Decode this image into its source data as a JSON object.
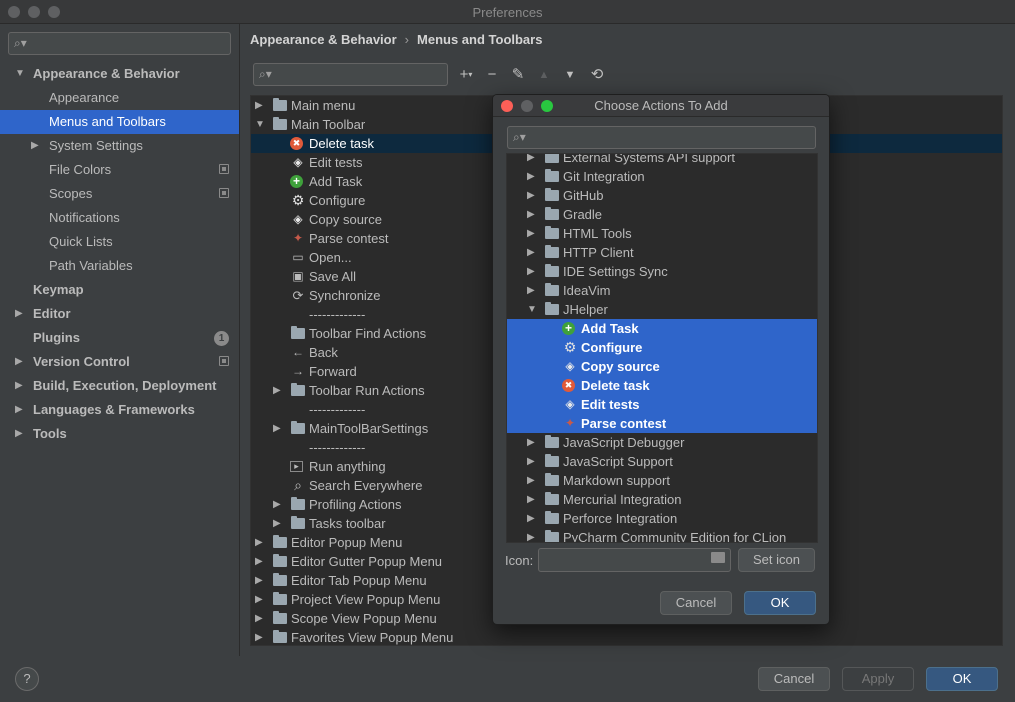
{
  "window": {
    "title": "Preferences"
  },
  "sidebar": {
    "search_placeholder": "",
    "items": [
      {
        "label": "Appearance & Behavior",
        "bold": true,
        "arrow": "down",
        "indent": 0
      },
      {
        "label": "Appearance",
        "indent": 1
      },
      {
        "label": "Menus and Toolbars",
        "indent": 1,
        "selected": true
      },
      {
        "label": "System Settings",
        "indent": 1,
        "arrow": "right"
      },
      {
        "label": "File Colors",
        "indent": 1,
        "project_icon": true
      },
      {
        "label": "Scopes",
        "indent": 1,
        "project_icon": true
      },
      {
        "label": "Notifications",
        "indent": 1
      },
      {
        "label": "Quick Lists",
        "indent": 1
      },
      {
        "label": "Path Variables",
        "indent": 1
      },
      {
        "label": "Keymap",
        "bold": true,
        "indent": 0
      },
      {
        "label": "Editor",
        "bold": true,
        "arrow": "right",
        "indent": 0
      },
      {
        "label": "Plugins",
        "bold": true,
        "indent": 0,
        "badge": "1"
      },
      {
        "label": "Version Control",
        "bold": true,
        "arrow": "right",
        "indent": 0,
        "project_icon": true
      },
      {
        "label": "Build, Execution, Deployment",
        "bold": true,
        "arrow": "right",
        "indent": 0
      },
      {
        "label": "Languages & Frameworks",
        "bold": true,
        "arrow": "right",
        "indent": 0
      },
      {
        "label": "Tools",
        "bold": true,
        "arrow": "right",
        "indent": 0
      }
    ]
  },
  "breadcrumb": {
    "parent": "Appearance & Behavior",
    "separator": "›",
    "current": "Menus and Toolbars"
  },
  "toolbar": {
    "search_placeholder": "",
    "icons": [
      "add-icon",
      "remove-icon",
      "edit-icon",
      "move-up-icon",
      "move-down-icon",
      "restore-icon"
    ]
  },
  "main_tree": [
    {
      "label": "Main menu",
      "level": 0,
      "arrow": "right",
      "icon": "folder"
    },
    {
      "label": "Main Toolbar",
      "level": 0,
      "arrow": "down",
      "icon": "folder"
    },
    {
      "label": "Delete task",
      "level": 1,
      "icon": "delete",
      "selected": true
    },
    {
      "label": "Edit tests",
      "level": 1,
      "icon": "tag"
    },
    {
      "label": "Add Task",
      "level": 1,
      "icon": "add"
    },
    {
      "label": "Configure",
      "level": 1,
      "icon": "gear"
    },
    {
      "label": "Copy source",
      "level": 1,
      "icon": "tag"
    },
    {
      "label": "Parse contest",
      "level": 1,
      "icon": "parse"
    },
    {
      "label": "Open...",
      "level": 1,
      "icon": "open"
    },
    {
      "label": "Save All",
      "level": 1,
      "icon": "save"
    },
    {
      "label": "Synchronize",
      "level": 1,
      "icon": "sync"
    },
    {
      "label": "-------------",
      "level": 1,
      "icon": "none"
    },
    {
      "label": "Toolbar Find Actions",
      "level": 1,
      "icon": "folder"
    },
    {
      "label": "Back",
      "level": 1,
      "icon": "back"
    },
    {
      "label": "Forward",
      "level": 1,
      "icon": "forward"
    },
    {
      "label": "Toolbar Run Actions",
      "level": 1,
      "arrow": "right",
      "icon": "folder"
    },
    {
      "label": "-------------",
      "level": 1,
      "icon": "none"
    },
    {
      "label": "MainToolBarSettings",
      "level": 1,
      "arrow": "right",
      "icon": "folder"
    },
    {
      "label": "-------------",
      "level": 1,
      "icon": "none"
    },
    {
      "label": "Run anything",
      "level": 1,
      "icon": "run"
    },
    {
      "label": "Search Everywhere",
      "level": 1,
      "icon": "search"
    },
    {
      "label": "Profiling Actions",
      "level": 1,
      "arrow": "right",
      "icon": "folder"
    },
    {
      "label": "Tasks toolbar",
      "level": 1,
      "arrow": "right",
      "icon": "folder"
    },
    {
      "label": "Editor Popup Menu",
      "level": 0,
      "arrow": "right",
      "icon": "folder"
    },
    {
      "label": "Editor Gutter Popup Menu",
      "level": 0,
      "arrow": "right",
      "icon": "folder"
    },
    {
      "label": "Editor Tab Popup Menu",
      "level": 0,
      "arrow": "right",
      "icon": "folder"
    },
    {
      "label": "Project View Popup Menu",
      "level": 0,
      "arrow": "right",
      "icon": "folder"
    },
    {
      "label": "Scope View Popup Menu",
      "level": 0,
      "arrow": "right",
      "icon": "folder"
    },
    {
      "label": "Favorites View Popup Menu",
      "level": 0,
      "arrow": "right",
      "icon": "folder"
    }
  ],
  "footer": {
    "help": "?",
    "cancel": "Cancel",
    "apply": "Apply",
    "ok": "OK"
  },
  "dialog": {
    "title": "Choose Actions To Add",
    "search_placeholder": "",
    "tree": [
      {
        "label": "External Systems API support",
        "level": 0,
        "arrow": "right",
        "icon": "folder"
      },
      {
        "label": "Git Integration",
        "level": 0,
        "arrow": "right",
        "icon": "folder"
      },
      {
        "label": "GitHub",
        "level": 0,
        "arrow": "right",
        "icon": "folder"
      },
      {
        "label": "Gradle",
        "level": 0,
        "arrow": "right",
        "icon": "folder"
      },
      {
        "label": "HTML Tools",
        "level": 0,
        "arrow": "right",
        "icon": "folder"
      },
      {
        "label": "HTTP Client",
        "level": 0,
        "arrow": "right",
        "icon": "folder"
      },
      {
        "label": "IDE Settings Sync",
        "level": 0,
        "arrow": "right",
        "icon": "folder"
      },
      {
        "label": "IdeaVim",
        "level": 0,
        "arrow": "right",
        "icon": "folder"
      },
      {
        "label": "JHelper",
        "level": 0,
        "arrow": "down",
        "icon": "folder"
      },
      {
        "label": "Add Task",
        "level": 1,
        "icon": "add",
        "selected": true
      },
      {
        "label": "Configure",
        "level": 1,
        "icon": "gear",
        "selected": true
      },
      {
        "label": "Copy source",
        "level": 1,
        "icon": "tag",
        "selected": true
      },
      {
        "label": "Delete task",
        "level": 1,
        "icon": "delete",
        "selected": true
      },
      {
        "label": "Edit tests",
        "level": 1,
        "icon": "tag",
        "selected": true
      },
      {
        "label": "Parse contest",
        "level": 1,
        "icon": "parse",
        "selected": true
      },
      {
        "label": "JavaScript Debugger",
        "level": 0,
        "arrow": "right",
        "icon": "folder"
      },
      {
        "label": "JavaScript Support",
        "level": 0,
        "arrow": "right",
        "icon": "folder"
      },
      {
        "label": "Markdown support",
        "level": 0,
        "arrow": "right",
        "icon": "folder"
      },
      {
        "label": "Mercurial Integration",
        "level": 0,
        "arrow": "right",
        "icon": "folder"
      },
      {
        "label": "Perforce Integration",
        "level": 0,
        "arrow": "right",
        "icon": "folder"
      },
      {
        "label": "PyCharm Community Edition for CLion",
        "level": 0,
        "arrow": "right",
        "icon": "folder"
      }
    ],
    "icon_label": "Icon:",
    "icon_value": "",
    "set_icon": "Set icon",
    "cancel": "Cancel",
    "ok": "OK"
  },
  "colors": {
    "background": "#3c3f41",
    "tree_background": "#2b2b2b",
    "selection": "#2f65ca",
    "inactive_selection": "#0d293e",
    "primary_button": "#365880"
  }
}
